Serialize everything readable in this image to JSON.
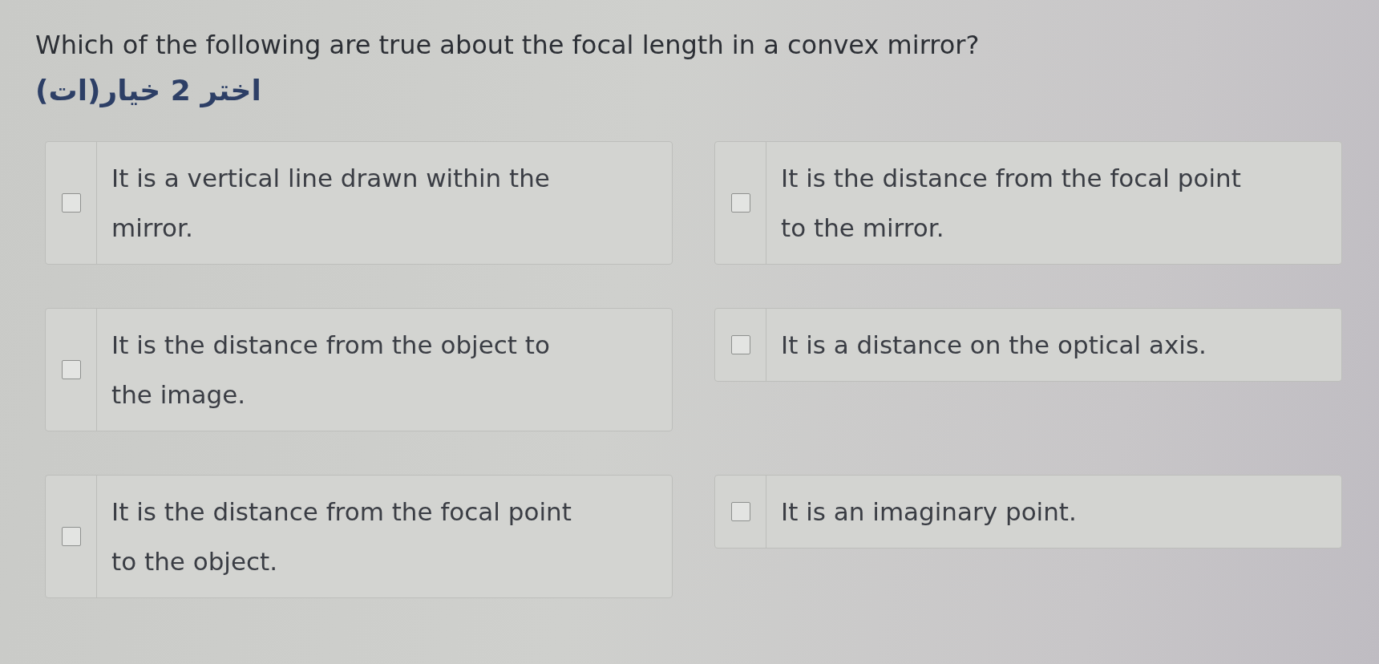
{
  "question": {
    "text": "Which of the following are true about the focal length in a convex mirror?",
    "instruction": "اختر 2 خيار(ات)"
  },
  "options": [
    {
      "text": "It is a vertical line drawn within the mirror.",
      "checked": false
    },
    {
      "text": "It is the distance from the focal point to the mirror.",
      "checked": false
    },
    {
      "text": "It is the distance from the object to the image.",
      "checked": false
    },
    {
      "text": "It is a distance on the optical axis.",
      "checked": false
    },
    {
      "text": "It is the distance from the focal point to the object.",
      "checked": false
    },
    {
      "text": "It is an imaginary point.",
      "checked": false
    }
  ]
}
